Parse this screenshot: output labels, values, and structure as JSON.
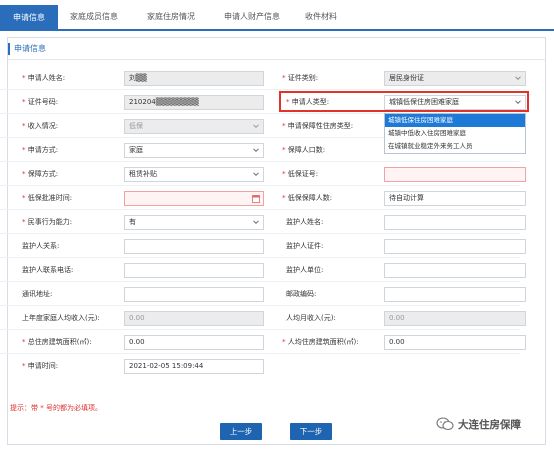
{
  "tabs": [
    {
      "label": "申请信息",
      "active": true
    },
    {
      "label": "家庭成员信息",
      "active": false
    },
    {
      "label": "家庭住房情况",
      "active": false
    },
    {
      "label": "申请人财产信息",
      "active": false
    },
    {
      "label": "收件材料",
      "active": false
    }
  ],
  "panel": {
    "title": "申请信息"
  },
  "form": {
    "applicant_name": {
      "label": "申请人姓名:",
      "value": "刘▒▒"
    },
    "id_type": {
      "label": "证件类别:",
      "value": "居民身份证"
    },
    "id_number": {
      "label": "证件号码:",
      "value": "210204▒▒▒▒▒▒▒▒"
    },
    "applicant_type": {
      "label": "申请人类型:",
      "value": "城镇低保住房困难家庭"
    },
    "income": {
      "label": "收入情况:",
      "value": "低保"
    },
    "housing_type": {
      "label": "申请保障性住房类型:",
      "value": ""
    },
    "apply_method": {
      "label": "申请方式:",
      "value": "家庭"
    },
    "household_count": {
      "label": "保障人口数:",
      "value": ""
    },
    "guarantee_method": {
      "label": "保障方式:",
      "value": "租赁补贴"
    },
    "dibao_cert": {
      "label": "低保证号:",
      "value": ""
    },
    "dibao_date": {
      "label": "低保批准时间:",
      "value": ""
    },
    "dibao_persons": {
      "label": "低保保障人数:",
      "value": "待自动计算"
    },
    "civil_capacity": {
      "label": "民事行为能力:",
      "value": "有"
    },
    "guardian_name": {
      "label": "监护人姓名:",
      "value": ""
    },
    "guardian_relation": {
      "label": "监护人关系:",
      "value": ""
    },
    "guardian_id": {
      "label": "监护人证件:",
      "value": ""
    },
    "guardian_phone": {
      "label": "监护人联系电话:",
      "value": ""
    },
    "guardian_unit": {
      "label": "监护人单位:",
      "value": ""
    },
    "address": {
      "label": "通讯地址:",
      "value": ""
    },
    "postcode": {
      "label": "邮政编码:",
      "value": ""
    },
    "last_year_income": {
      "label": "上年度家庭人均收入(元):",
      "value": "0.00"
    },
    "monthly_income": {
      "label": "人均月收入(元):",
      "value": "0.00"
    },
    "total_area": {
      "label": "总住房建筑面积(㎡):",
      "value": "0.00"
    },
    "per_capita_area": {
      "label": "人均住房建筑面积(㎡):",
      "value": "0.00"
    },
    "apply_time": {
      "label": "申请时间:",
      "value": "2021-02-05 15:09:44"
    }
  },
  "dropdown_options": [
    "城镇低保住房困难家庭",
    "城镇中低收入住房困难家庭",
    "在城镇就业稳定外来务工人员"
  ],
  "hint": "提示：带 * 号的都为必填项。",
  "buttons": {
    "prev": "上一步",
    "next": "下一步"
  },
  "watermark": "大连住房保障",
  "colors": {
    "primary": "#2a6ebb",
    "highlight": "#e2332b",
    "required": "#e03030"
  }
}
